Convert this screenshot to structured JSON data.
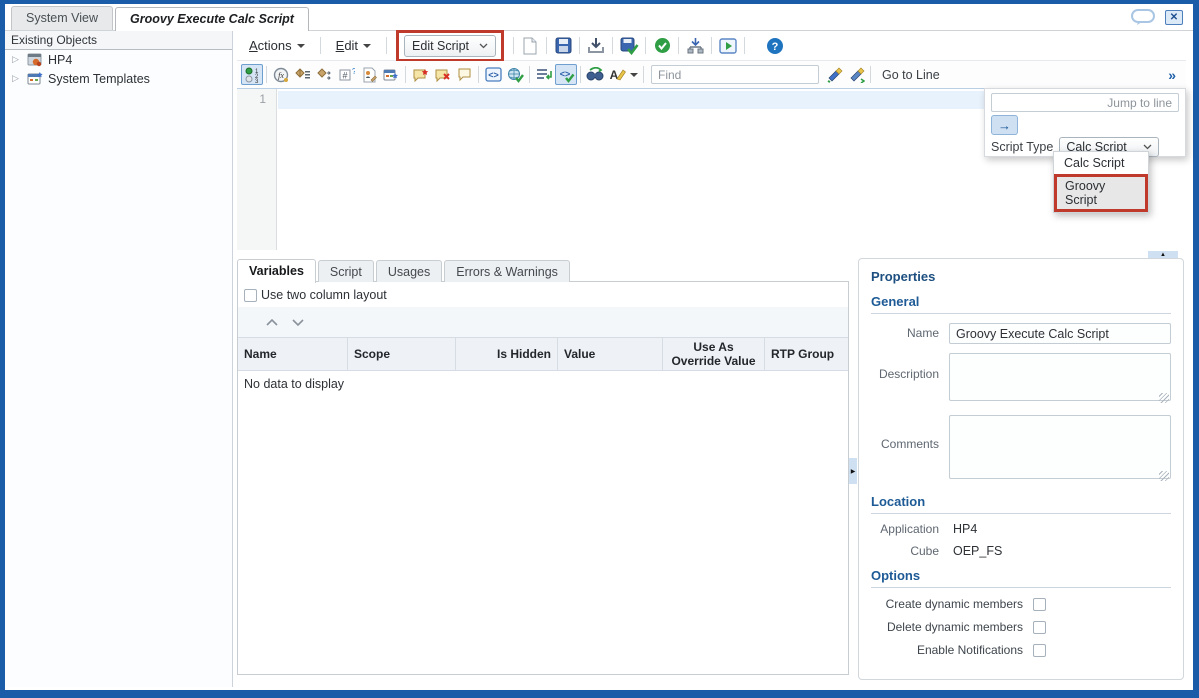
{
  "window": {
    "tabs": [
      {
        "label": "System View",
        "active": false
      },
      {
        "label": "Groovy Execute Calc Script",
        "active": true
      }
    ]
  },
  "sidebar": {
    "header": "Existing Objects",
    "items": [
      {
        "label": "HP4"
      },
      {
        "label": "System Templates"
      }
    ]
  },
  "menubar": {
    "actions_mnemonic": "A",
    "actions_rest": "ctions",
    "edit_mnemonic": "E",
    "edit_rest": "dit",
    "edit_script_label": "Edit Script"
  },
  "toolbar": {
    "find_placeholder": "Find",
    "goto_line_label": "Go to Line",
    "overflow_glyph": "»"
  },
  "goto_popup": {
    "jump_placeholder": "Jump to line",
    "arrow_glyph": "→",
    "script_type_label": "Script Type",
    "script_type_value": "Calc Script",
    "options": [
      "Calc Script",
      "Groovy Script"
    ]
  },
  "editor": {
    "line_number": "1"
  },
  "bottom_panel": {
    "tabs": [
      {
        "label": "Variables",
        "active": true
      },
      {
        "label": "Script",
        "active": false
      },
      {
        "label": "Usages",
        "active": false
      },
      {
        "label": "Errors & Warnings",
        "active": false
      }
    ],
    "two_column_label": "Use two column layout",
    "columns": [
      "Name",
      "Scope",
      "Is Hidden",
      "Value",
      "Use As Override Value",
      "RTP Group"
    ],
    "empty_text": "No data to display"
  },
  "properties": {
    "title": "Properties",
    "general_title": "General",
    "name_label": "Name",
    "name_value": "Groovy Execute Calc Script",
    "description_label": "Description",
    "comments_label": "Comments",
    "location_title": "Location",
    "application_label": "Application",
    "application_value": "HP4",
    "cube_label": "Cube",
    "cube_value": "OEP_FS",
    "options_title": "Options",
    "option_checkboxes": [
      "Create dynamic members",
      "Delete dynamic members",
      "Enable Notifications"
    ]
  },
  "colors": {
    "frame": "#1a5ca8",
    "callout": "#bf3a2b",
    "accent": "#1f74c0",
    "section_heading": "#1d5a96",
    "current_line": "#e8f2fc"
  },
  "icons": {
    "close-icon": "✕",
    "chat-bubble-icon": "speech-bubble-outline",
    "expand-icon": "▷",
    "new-script-icon": "blank-page",
    "save-icon": "floppy-disk",
    "save-as-icon": "tray-down-arrow",
    "validate-save-icon": "floppy-check",
    "validate-icon": "green-check-circle",
    "deploy-icon": "deploy-tree",
    "debug-icon": "play-box",
    "help-icon": "?",
    "collapse-up-icon": "▲",
    "collapse-right-icon": "▶",
    "move-up-icon": "chevron-up",
    "move-down-icon": "chevron-down"
  }
}
